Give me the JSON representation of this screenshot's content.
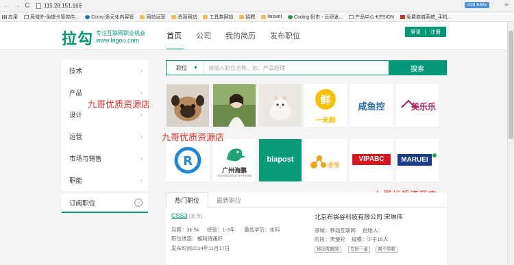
{
  "browser": {
    "url": "115.28.151.169",
    "speed": "418 KB/s",
    "bookmarks": [
      "应用",
      "局域外-免提卡管控件...",
      "Ccms-多元化内容管",
      "网站运营",
      "资源网站",
      "工具类网站",
      "招聘",
      "laravel",
      "Coding 码市 - 云研发...",
      "产品中心-KESION",
      "免费商城系统_手机..."
    ]
  },
  "header": {
    "logo": "拉勾",
    "slogan": "专注互联网职业机会",
    "domain": "www.lagou.com",
    "nav": [
      "首页",
      "公司",
      "我的简历",
      "发布职位"
    ],
    "login": "登录",
    "divider": "|",
    "register": "注册"
  },
  "sidebar": {
    "items": [
      "技术",
      "产品",
      "设计",
      "运营",
      "市场与销售",
      "职能"
    ],
    "subscribe": "订阅职位"
  },
  "search": {
    "category": "职位",
    "placeholder": "请输入职位名称，如：产品经理",
    "button": "搜索"
  },
  "companies": {
    "yimixian": "一米鲜",
    "xianyukong": "咸鱼控",
    "meilele": "美乐乐",
    "guangzhou_haipeng": "广州海鹏",
    "guangzhou_haipeng_en": "GUANGZHOU HAIPENG",
    "biapost": "biapost",
    "tongchuang": "通懂",
    "vipabc": "VIPABC",
    "marvel": "MARUEI"
  },
  "watermark": "九哥优质资源店",
  "jobs": {
    "tabs": [
      "热门职位",
      "最新职位"
    ],
    "first": {
      "title": "CSS3",
      "city": "[北京]",
      "salary": "月薪：3k-5k",
      "experience": "经验：1-3年",
      "education": "最低学历：本科",
      "temptation": "职位诱惑：福利待遇好",
      "published": "发布时间2014年11月17日",
      "company": "北京布袋谷科技有限公司 宋琳伟",
      "field": "领域：移动互联网",
      "founder": "创始人：",
      "stage": "阶段：天使轮",
      "scale": "规模：少于15人",
      "tags": [
        "移动互联网",
        "五险一金",
        "两个带薪"
      ]
    }
  }
}
